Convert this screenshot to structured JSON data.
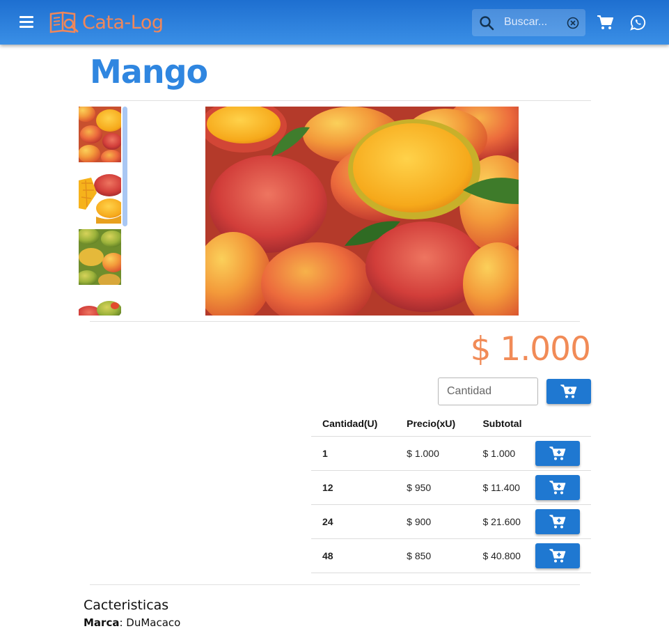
{
  "header": {
    "brand": "Cata-Log",
    "search_placeholder": "Buscar...",
    "accent_color": "#1e6fd0",
    "icons": [
      "menu-icon",
      "book-logo-icon",
      "search-icon",
      "clear-icon",
      "cart-icon",
      "whatsapp-icon"
    ]
  },
  "product": {
    "title": "Mango",
    "price": "$ 1.000",
    "quantity_placeholder": "Cantidad",
    "thumbnail_count": 4
  },
  "pricing_table": {
    "headers": [
      "Cantidad(U)",
      "Precio(xU)",
      "Subtotal"
    ],
    "rows": [
      {
        "qty": "1",
        "unit_price": "$ 1.000",
        "subtotal": "$ 1.000"
      },
      {
        "qty": "12",
        "unit_price": "$ 950",
        "subtotal": "$ 11.400"
      },
      {
        "qty": "24",
        "unit_price": "$ 900",
        "subtotal": "$ 21.600"
      },
      {
        "qty": "48",
        "unit_price": "$ 850",
        "subtotal": "$ 40.800"
      }
    ]
  },
  "characteristics": {
    "title": "Cacteristicas",
    "brand_label": "Marca",
    "brand_value": "DuMacaco"
  },
  "colors": {
    "title_blue": "#2f86e0",
    "price_orange": "#f18b57",
    "button_blue": "#1f78d1"
  }
}
